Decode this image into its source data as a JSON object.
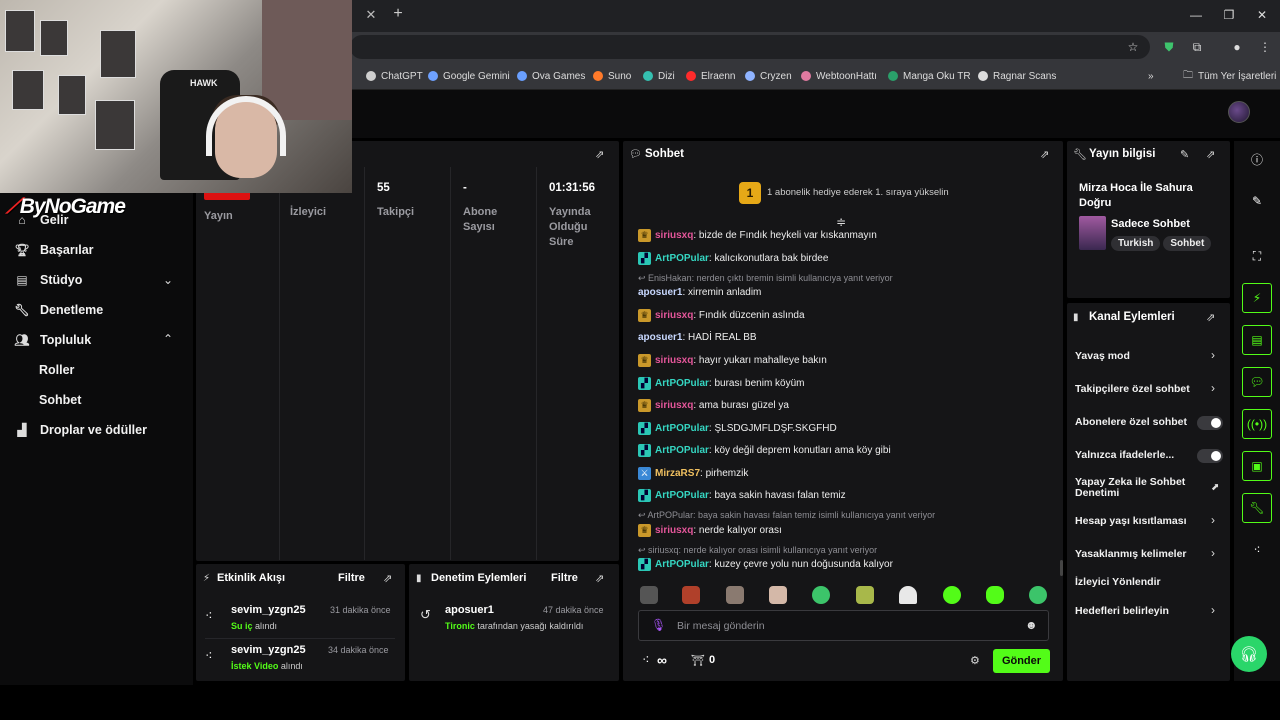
{
  "browser": {
    "close_tab": "✕",
    "new_tab": "+",
    "bookmarks": [
      {
        "label": "ChatGPT",
        "color": "#cfcfcf"
      },
      {
        "label": "Google Gemini",
        "color": "#6ea1ff"
      },
      {
        "label": "Ova Games",
        "color": "#6aa0ff"
      },
      {
        "label": "Suno",
        "color": "#ff7a2a"
      },
      {
        "label": "Dizi",
        "color": "#35c0b0"
      },
      {
        "label": "Elraenn",
        "color": "#ff2b2b"
      },
      {
        "label": "Cryzen",
        "color": "#8fb3ff"
      },
      {
        "label": "WebtoonHattı",
        "color": "#e07aa0"
      },
      {
        "label": "Manga Oku TR",
        "color": "#2aa06a"
      },
      {
        "label": "Ragnar Scans",
        "color": "#dddddd"
      }
    ],
    "bookmarks_more": "»",
    "all_bookmarks": "Tüm Yer İşaretleri"
  },
  "webcam": {
    "chair_logo": "HAWK"
  },
  "brand": {
    "overlay": "ByNoGame"
  },
  "sidebar": {
    "items": [
      {
        "label": "Gelir",
        "icon": "home-icon"
      },
      {
        "label": "Başarılar",
        "icon": "trophy-icon"
      },
      {
        "label": "Stüdyo",
        "icon": "studio-icon"
      },
      {
        "label": "Denetleme",
        "icon": "wrench-icon"
      },
      {
        "label": "Topluluk",
        "icon": "community-icon"
      },
      {
        "label": "Roller"
      },
      {
        "label": "Sohbet"
      },
      {
        "label": "Droplar ve ödüller",
        "icon": "drops-icon"
      }
    ]
  },
  "stats": {
    "columns": [
      {
        "value": "",
        "label": "Yayın"
      },
      {
        "value": "",
        "label": "İzleyici"
      },
      {
        "value": "55",
        "label": "Takipçi"
      },
      {
        "value": "-",
        "label": "Abone Sayısı"
      },
      {
        "value": "01:31:56",
        "label": "Yayında Olduğu Süre"
      }
    ]
  },
  "chat": {
    "title": "Sohbet",
    "pinned": {
      "rank": "1",
      "text": "1 abonelik hediye ederek 1. sıraya yükselin"
    },
    "messages": [
      {
        "user": "siriusxq",
        "text": ": bizde de Fındık heykeli var kıskanmayın"
      },
      {
        "user": "ArtPOPular",
        "text": ": kalıcıkonutlara bak birdee"
      },
      {
        "user": "EnisHakan",
        "reply": "EnisHakan: nerden çıktı bremin isimli kullanıcıya yanıt veriyor"
      },
      {
        "user": "aposuer1",
        "text": ": xirremin anladim"
      },
      {
        "user": "siriusxq",
        "text": ": Fındık düzcenin aslında"
      },
      {
        "user": "aposuer1",
        "text": ": HADİ REAL BB"
      },
      {
        "user": "siriusxq",
        "text": ": hayır yukarı mahalleye bakın"
      },
      {
        "user": "ArtPOPular",
        "text": ": burası benim köyüm"
      },
      {
        "user": "siriusxq",
        "text": ": ama burası güzel ya"
      },
      {
        "user": "ArtPOPular",
        "text": ": ŞLSDGJMFLDŞF.SKGFHD"
      },
      {
        "user": "ArtPOPular",
        "text": ": köy değil deprem konutları ama köy gibi"
      },
      {
        "user": "MirzaRS7",
        "text": ": pirhemzik"
      },
      {
        "user": "ArtPOPular",
        "text": ": baya sakin havası falan temiz"
      },
      {
        "user": "ArtPOPular",
        "reply": "ArtPOPular: baya sakin havası falan temiz isimli kullanıcıya yanıt veriyor"
      },
      {
        "user": "siriusxq",
        "text": ": nerde kalıyor orası"
      },
      {
        "user": "siriusxq",
        "reply": "siriusxq: nerde kalıyor orası isimli kullanıcıya yanıt veriyor"
      },
      {
        "user": "ArtPOPular",
        "text": ": kuzey çevre yolu nun doğusunda kalıyor"
      }
    ],
    "input_placeholder": "Bir mesaj gönderin",
    "infinity": "∞",
    "gift_count": "0",
    "send_label": "Gönder"
  },
  "activity": {
    "title": "Etkinlik Akışı",
    "filter": "Filtre",
    "items": [
      {
        "user": "sevim_yzgn25",
        "time": "31 dakika önce",
        "item": "Su iç",
        "suffix": " alındı"
      },
      {
        "user": "sevim_yzgn25",
        "time": "34 dakika önce",
        "item": "İstek Video",
        "suffix": " alındı"
      }
    ]
  },
  "moderation": {
    "title": "Denetim Eylemleri",
    "filter": "Filtre",
    "items": [
      {
        "user": "aposuer1",
        "time": "47 dakika önce",
        "actor": "Tironic",
        "text": " tarafından yasağı kaldırıldı"
      }
    ]
  },
  "stream_info": {
    "title": "Yayın bilgisi",
    "stream_title": "Mirza Hoca İle Sahura Doğru",
    "category": "Sadece Sohbet",
    "tags": [
      "Turkish",
      "Sohbet"
    ]
  },
  "channel_actions": {
    "title": "Kanal Eylemleri",
    "items": [
      {
        "label": "Yavaş mod",
        "control": "chevron"
      },
      {
        "label": "Takipçilere özel sohbet",
        "control": "chevron"
      },
      {
        "label": "Abonelere özel sohbet",
        "control": "toggle",
        "on": false
      },
      {
        "label": "Yalnızca ifadelerle...",
        "control": "toggle",
        "on": false
      },
      {
        "label": "Yapay Zeka ile Sohbet Denetimi",
        "control": "external"
      },
      {
        "label": "Hesap yaşı kısıtlaması",
        "control": "chevron"
      },
      {
        "label": "Yasaklanmış kelimeler",
        "control": "chevron"
      },
      {
        "label": "İzleyici Yönlendir",
        "control": "none"
      },
      {
        "label": "Hedefleri belirleyin",
        "control": "chevron"
      }
    ]
  },
  "colors": {
    "accent": "#53fc18",
    "panel": "#151517",
    "background": "#0b0b0c"
  }
}
